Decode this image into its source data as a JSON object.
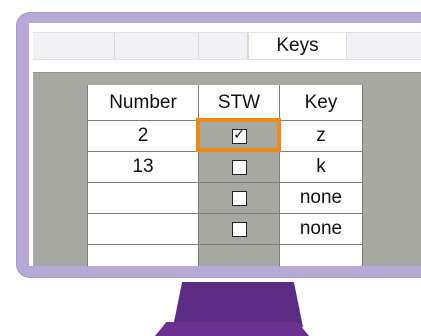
{
  "colors": {
    "monitor_frame": "#b7a9d6",
    "panel_background": "#a8a8a3",
    "highlight": "#ef8a12",
    "stand": "#5b2c83"
  },
  "tabs": {
    "active_label": "Keys"
  },
  "table": {
    "headers": [
      "Number",
      "STW",
      "Key"
    ],
    "rows": [
      {
        "number": "2",
        "stw_checked": true,
        "key": "z"
      },
      {
        "number": "13",
        "stw_checked": false,
        "key": "k"
      },
      {
        "number": "",
        "stw_checked": false,
        "key": "none"
      },
      {
        "number": "",
        "stw_checked": false,
        "key": "none"
      }
    ]
  },
  "icons": {
    "checked": "checkbox-checked-icon",
    "unchecked": "checkbox-unchecked-icon"
  }
}
